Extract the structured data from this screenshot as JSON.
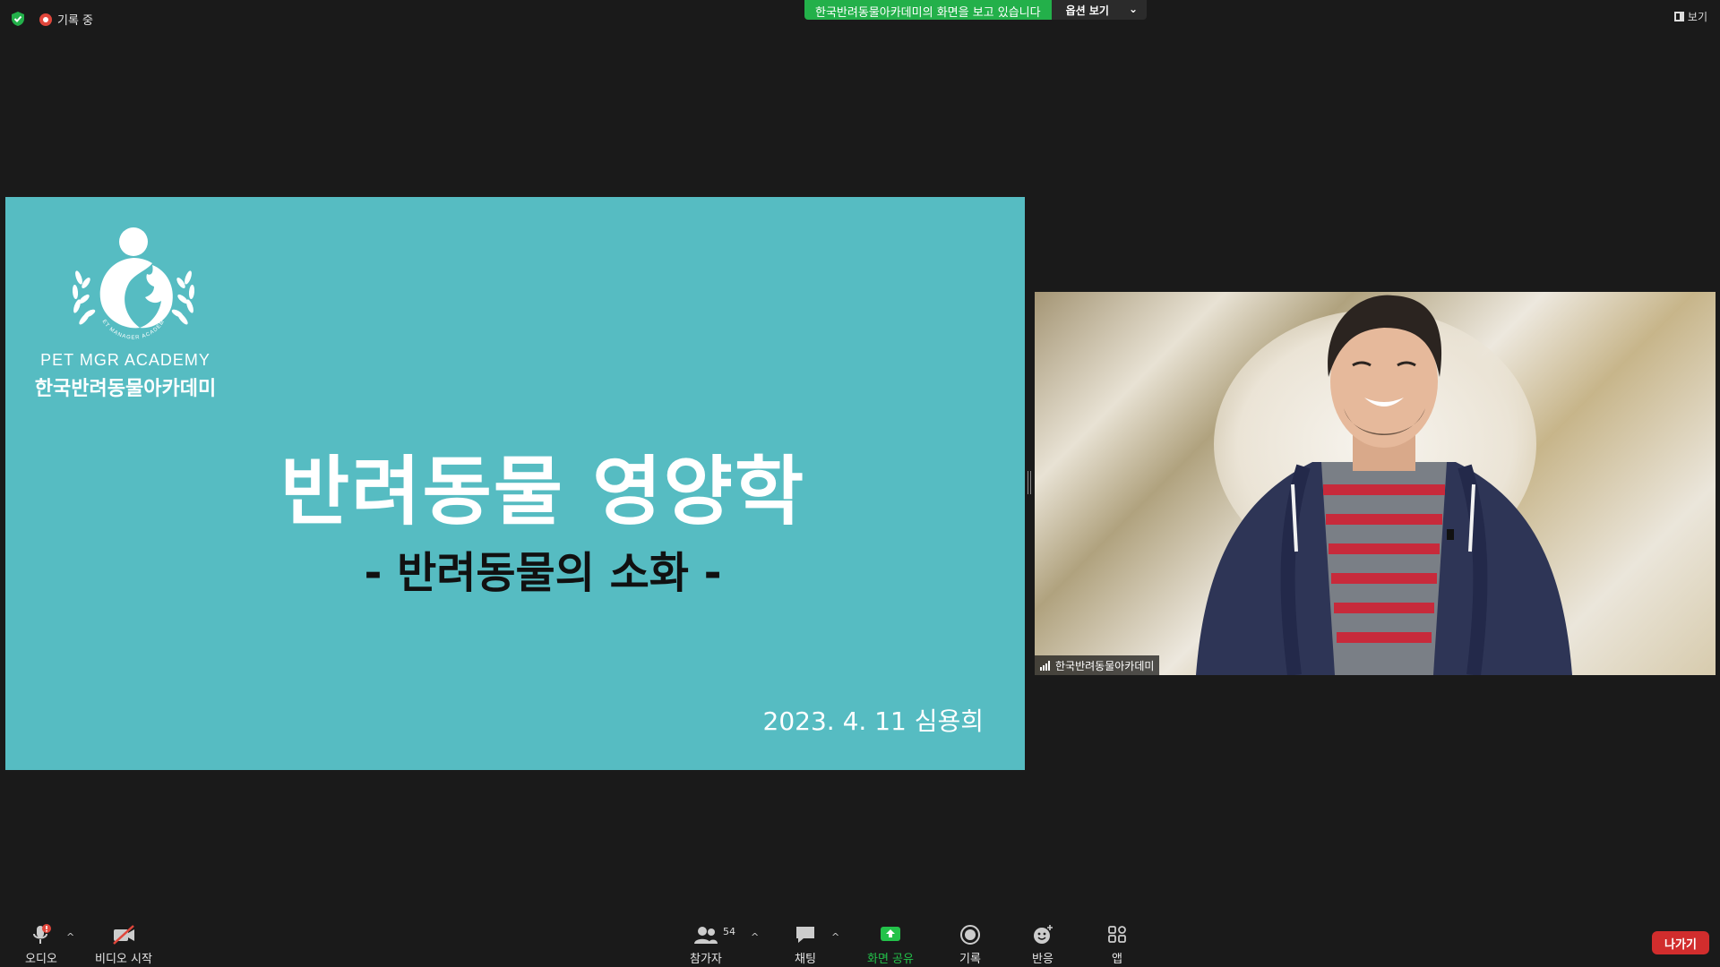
{
  "top_bar": {
    "recording_label": "기록 중",
    "share_banner_text": "한국반려동물아카데미의 화면을 보고 있습니다",
    "view_options_label": "옵션 보기",
    "view_options_caret": "⌄",
    "view_label": "보기"
  },
  "slide": {
    "logo_tagline": "PET MANAGER ACADEMY",
    "logo_en": "PET MGR ACADEMY",
    "logo_ko": "한국반려동물아카데미",
    "title": "반려동물 영양학",
    "subtitle": "- 반려동물의 소화 -",
    "date_author": "2023. 4. 11  심용희"
  },
  "video": {
    "participant_name": "한국반려동물아카데미"
  },
  "toolbar": {
    "audio_label": "오디오",
    "audio_caret": "^",
    "video_label": "비디오 시작",
    "participants_label": "참가자",
    "participants_count": "54",
    "participants_caret": "^",
    "chat_label": "채팅",
    "chat_caret": "^",
    "share_label": "화면 공유",
    "record_label": "기록",
    "reactions_label": "반응",
    "apps_label": "앱",
    "leave_label": "나가기"
  },
  "colors": {
    "slide_bg": "#56bcc2",
    "share_green": "#23b04a",
    "leave_red": "#d12d2d",
    "app_bg": "#1a1a1a"
  }
}
